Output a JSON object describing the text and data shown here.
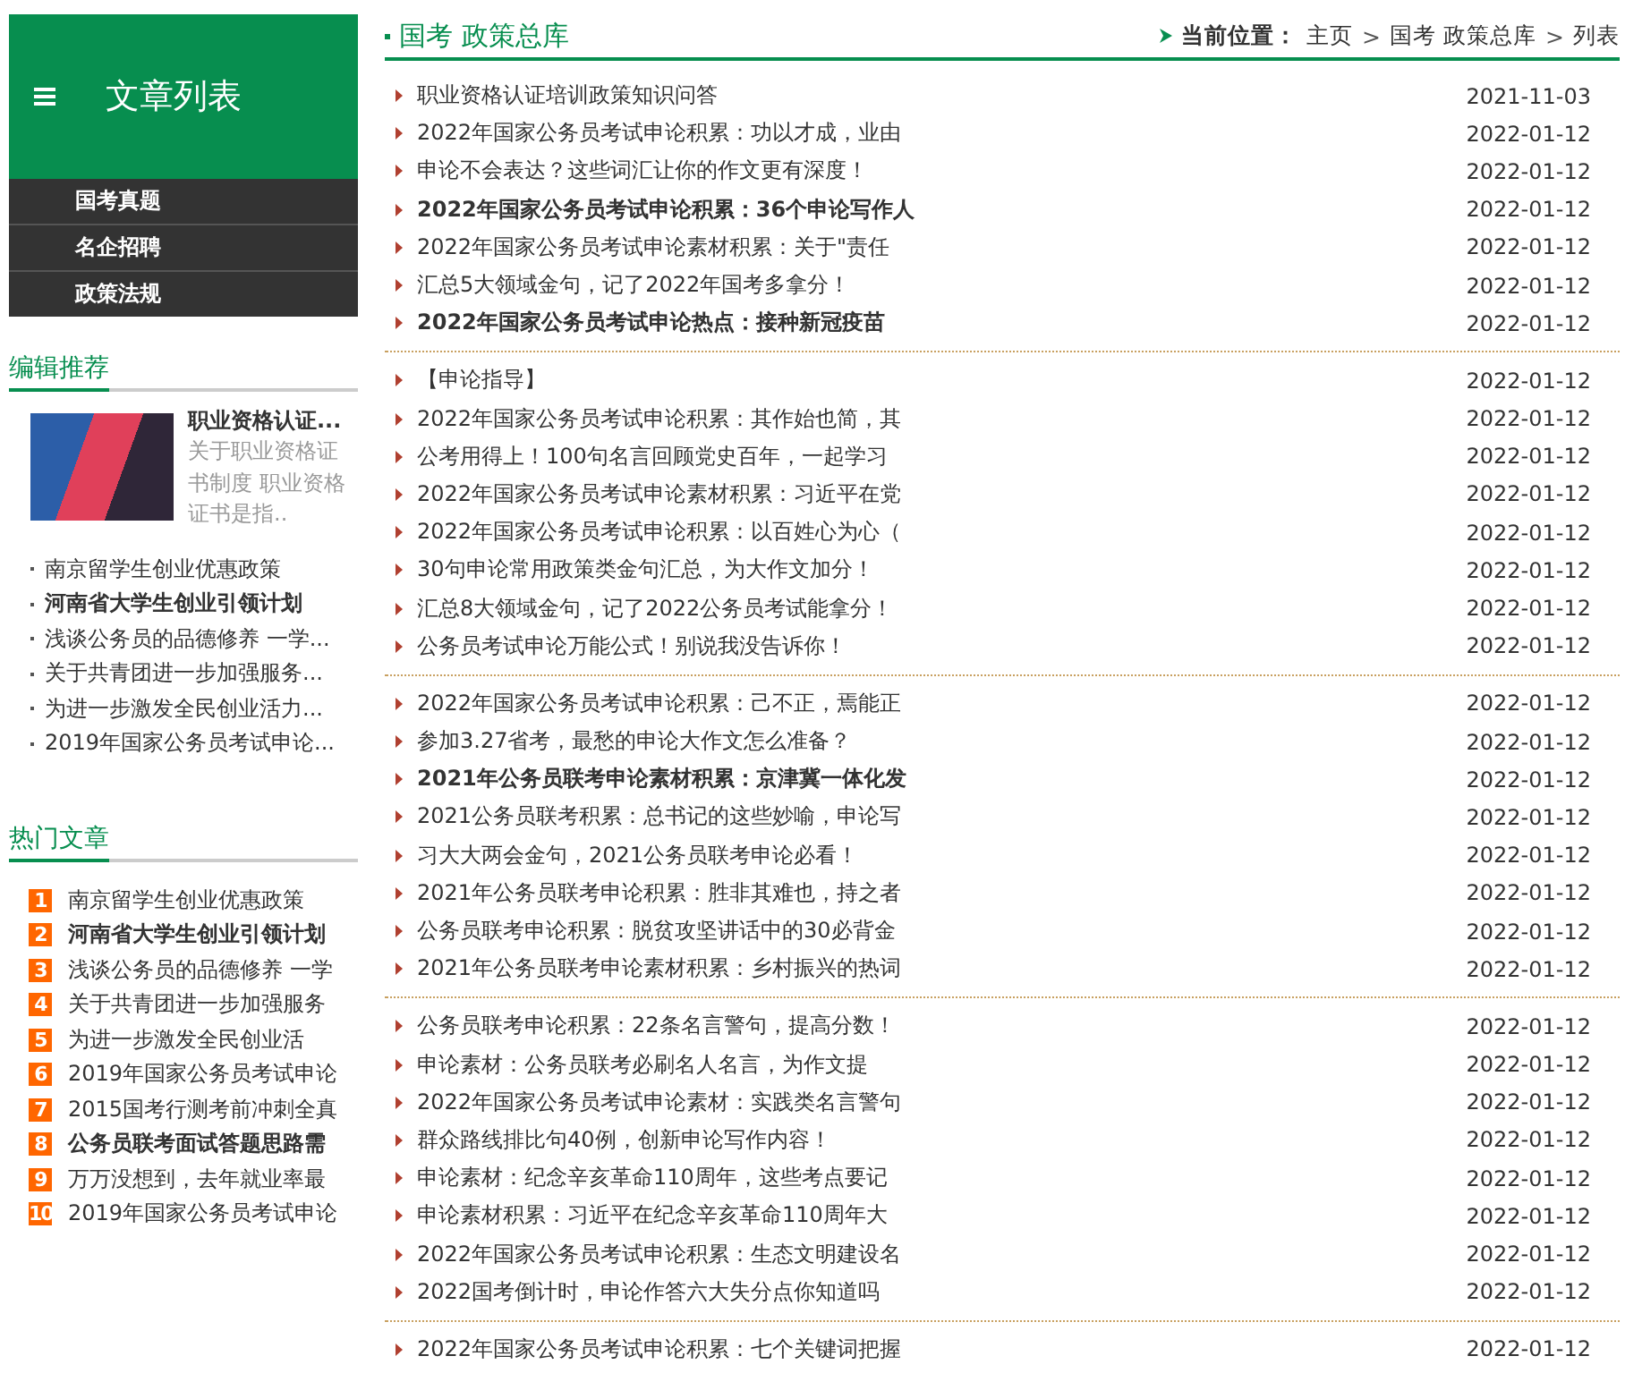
{
  "sidebar": {
    "title": "文章列表",
    "menu": [
      {
        "label": "国考真题"
      },
      {
        "label": "名企招聘"
      },
      {
        "label": "政策法规"
      }
    ],
    "editor_picks": {
      "heading": "编辑推荐",
      "feature": {
        "title": "职业资格认证...",
        "summary": "关于职业资格证书制度 职业资格证书是指.."
      },
      "items": [
        {
          "title": "南京留学生创业优惠政策",
          "bold": false
        },
        {
          "title": "河南省大学生创业引领计划",
          "bold": true
        },
        {
          "title": "浅谈公务员的品德修养 一学...",
          "bold": false
        },
        {
          "title": "关于共青团进一步加强服务...",
          "bold": false
        },
        {
          "title": "为进一步激发全民创业活力...",
          "bold": false
        },
        {
          "title": "2019年国家公务员考试申论...",
          "bold": false
        }
      ]
    },
    "hot": {
      "heading": "热门文章",
      "items": [
        {
          "rank": "1",
          "title": "南京留学生创业优惠政策",
          "bold": false
        },
        {
          "rank": "2",
          "title": "河南省大学生创业引领计划",
          "bold": true
        },
        {
          "rank": "3",
          "title": "浅谈公务员的品德修养 一学",
          "bold": false
        },
        {
          "rank": "4",
          "title": "关于共青团进一步加强服务",
          "bold": false
        },
        {
          "rank": "5",
          "title": "为进一步激发全民创业活",
          "bold": false
        },
        {
          "rank": "6",
          "title": "2019年国家公务员考试申论",
          "bold": false
        },
        {
          "rank": "7",
          "title": "2015国考行测考前冲刺全真",
          "bold": false
        },
        {
          "rank": "8",
          "title": "公务员联考面试答题思路需",
          "bold": true
        },
        {
          "rank": "9",
          "title": "万万没想到，去年就业率最",
          "bold": false
        },
        {
          "rank": "10",
          "title": "2019年国家公务员考试申论",
          "bold": false
        }
      ]
    }
  },
  "main": {
    "title": "国考 政策总库",
    "breadcrumb": {
      "label": "当前位置：",
      "items": [
        "主页",
        "国考 政策总库",
        "列表"
      ],
      "separator": ">"
    },
    "groups": [
      {
        "rows": [
          {
            "title": "职业资格认证培训政策知识问答",
            "date": "2021-11-03",
            "bold": false
          },
          {
            "title": "2022年国家公务员考试申论积累：功以才成，业由",
            "date": "2022-01-12",
            "bold": false
          },
          {
            "title": "申论不会表达？这些词汇让你的作文更有深度！",
            "date": "2022-01-12",
            "bold": false
          },
          {
            "title": "2022年国家公务员考试申论积累：36个申论写作人",
            "date": "2022-01-12",
            "bold": true
          },
          {
            "title": "2022年国家公务员考试申论素材积累：关于\"责任",
            "date": "2022-01-12",
            "bold": false
          },
          {
            "title": "汇总5大领域金句，记了2022年国考多拿分！",
            "date": "2022-01-12",
            "bold": false
          },
          {
            "title": "2022年国家公务员考试申论热点：接种新冠疫苗",
            "date": "2022-01-12",
            "bold": true
          }
        ]
      },
      {
        "rows": [
          {
            "title": "【申论指导】",
            "date": "2022-01-12",
            "bold": false
          },
          {
            "title": "2022年国家公务员考试申论积累：其作始也简，其",
            "date": "2022-01-12",
            "bold": false
          },
          {
            "title": "公考用得上！100句名言回顾党史百年，一起学习",
            "date": "2022-01-12",
            "bold": false
          },
          {
            "title": "2022年国家公务员考试申论素材积累：习近平在党",
            "date": "2022-01-12",
            "bold": false
          },
          {
            "title": "2022年国家公务员考试申论积累：以百姓心为心（",
            "date": "2022-01-12",
            "bold": false
          },
          {
            "title": "30句申论常用政策类金句汇总，为大作文加分！",
            "date": "2022-01-12",
            "bold": false
          },
          {
            "title": "汇总8大领域金句，记了2022公务员考试能拿分！",
            "date": "2022-01-12",
            "bold": false
          },
          {
            "title": "公务员考试申论万能公式！别说我没告诉你！",
            "date": "2022-01-12",
            "bold": false
          }
        ]
      },
      {
        "rows": [
          {
            "title": "2022年国家公务员考试申论积累：己不正，焉能正",
            "date": "2022-01-12",
            "bold": false
          },
          {
            "title": "参加3.27省考，最愁的申论大作文怎么准备？",
            "date": "2022-01-12",
            "bold": false
          },
          {
            "title": "2021年公务员联考申论素材积累：京津冀一体化发",
            "date": "2022-01-12",
            "bold": true
          },
          {
            "title": "2021公务员联考积累：总书记的这些妙喻，申论写",
            "date": "2022-01-12",
            "bold": false
          },
          {
            "title": "习大大两会金句，2021公务员联考申论必看！",
            "date": "2022-01-12",
            "bold": false
          },
          {
            "title": "2021年公务员联考申论积累：胜非其难也，持之者",
            "date": "2022-01-12",
            "bold": false
          },
          {
            "title": "公务员联考申论积累：脱贫攻坚讲话中的30必背金",
            "date": "2022-01-12",
            "bold": false
          },
          {
            "title": "2021年公务员联考申论素材积累：乡村振兴的热词",
            "date": "2022-01-12",
            "bold": false
          }
        ]
      },
      {
        "rows": [
          {
            "title": "公务员联考申论积累：22条名言警句，提高分数！",
            "date": "2022-01-12",
            "bold": false
          },
          {
            "title": "申论素材：公务员联考必刷名人名言，为作文提",
            "date": "2022-01-12",
            "bold": false
          },
          {
            "title": "2022年国家公务员考试申论素材：实践类名言警句",
            "date": "2022-01-12",
            "bold": false
          },
          {
            "title": "群众路线排比句40例，创新申论写作内容！",
            "date": "2022-01-12",
            "bold": false
          },
          {
            "title": "申论素材：纪念辛亥革命110周年，这些考点要记",
            "date": "2022-01-12",
            "bold": false
          },
          {
            "title": "申论素材积累：习近平在纪念辛亥革命110周年大",
            "date": "2022-01-12",
            "bold": false
          },
          {
            "title": "2022年国家公务员考试申论积累：生态文明建设名",
            "date": "2022-01-12",
            "bold": false
          },
          {
            "title": "2022国考倒计时，申论作答六大失分点你知道吗",
            "date": "2022-01-12",
            "bold": false
          }
        ]
      },
      {
        "rows": [
          {
            "title": "2022年国家公务员考试申论积累：七个关键词把握",
            "date": "2022-01-12",
            "bold": false
          }
        ]
      }
    ]
  }
}
